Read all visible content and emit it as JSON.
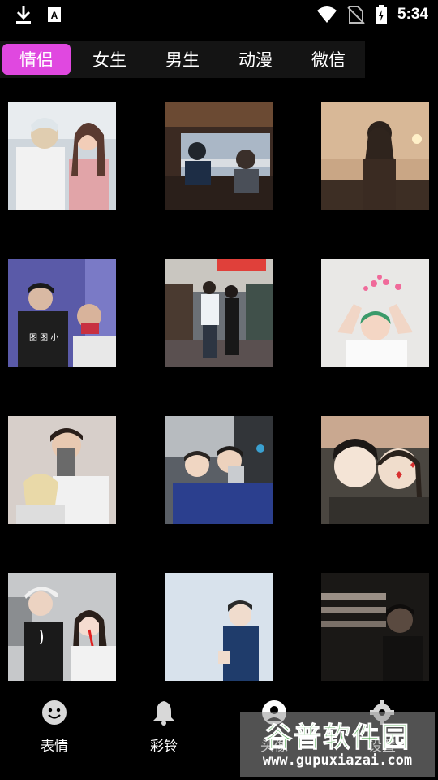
{
  "status_bar": {
    "time": "5:34",
    "icons": [
      "download-icon",
      "text-app-icon",
      "wifi-icon",
      "no-sim-icon",
      "battery-icon"
    ]
  },
  "tabs": [
    {
      "label": "情侣",
      "active": true
    },
    {
      "label": "女生",
      "active": false
    },
    {
      "label": "男生",
      "active": false
    },
    {
      "label": "动漫",
      "active": false
    },
    {
      "label": "微信",
      "active": false
    }
  ],
  "colors": {
    "background": "#000000",
    "tab_bar": "#141414",
    "active_tab": "#e048e0",
    "nav_icon": "#d8d8d8"
  },
  "avatars": [
    {
      "name": "couple-hug-outdoor"
    },
    {
      "name": "couple-cafe-window"
    },
    {
      "name": "girl-sunset-silhouette"
    },
    {
      "name": "couple-purple-backdrop"
    },
    {
      "name": "couple-street-walk"
    },
    {
      "name": "girl-heart-hands"
    },
    {
      "name": "couple-phone-selfie"
    },
    {
      "name": "couple-mirror-selfie"
    },
    {
      "name": "couple-face-mask"
    },
    {
      "name": "couple-cap-red-straw"
    },
    {
      "name": "boy-blue-jacket"
    },
    {
      "name": "boy-dark-window-shadow"
    }
  ],
  "bottom_nav": [
    {
      "label": "表情",
      "icon": "smiley-icon"
    },
    {
      "label": "彩铃",
      "icon": "bell-icon"
    },
    {
      "label": "头像",
      "icon": "avatar-icon"
    },
    {
      "label": "设置",
      "icon": "gear-icon"
    }
  ],
  "watermark": {
    "title": "谷普软件园",
    "url": "www.gupuxiazai.com"
  }
}
